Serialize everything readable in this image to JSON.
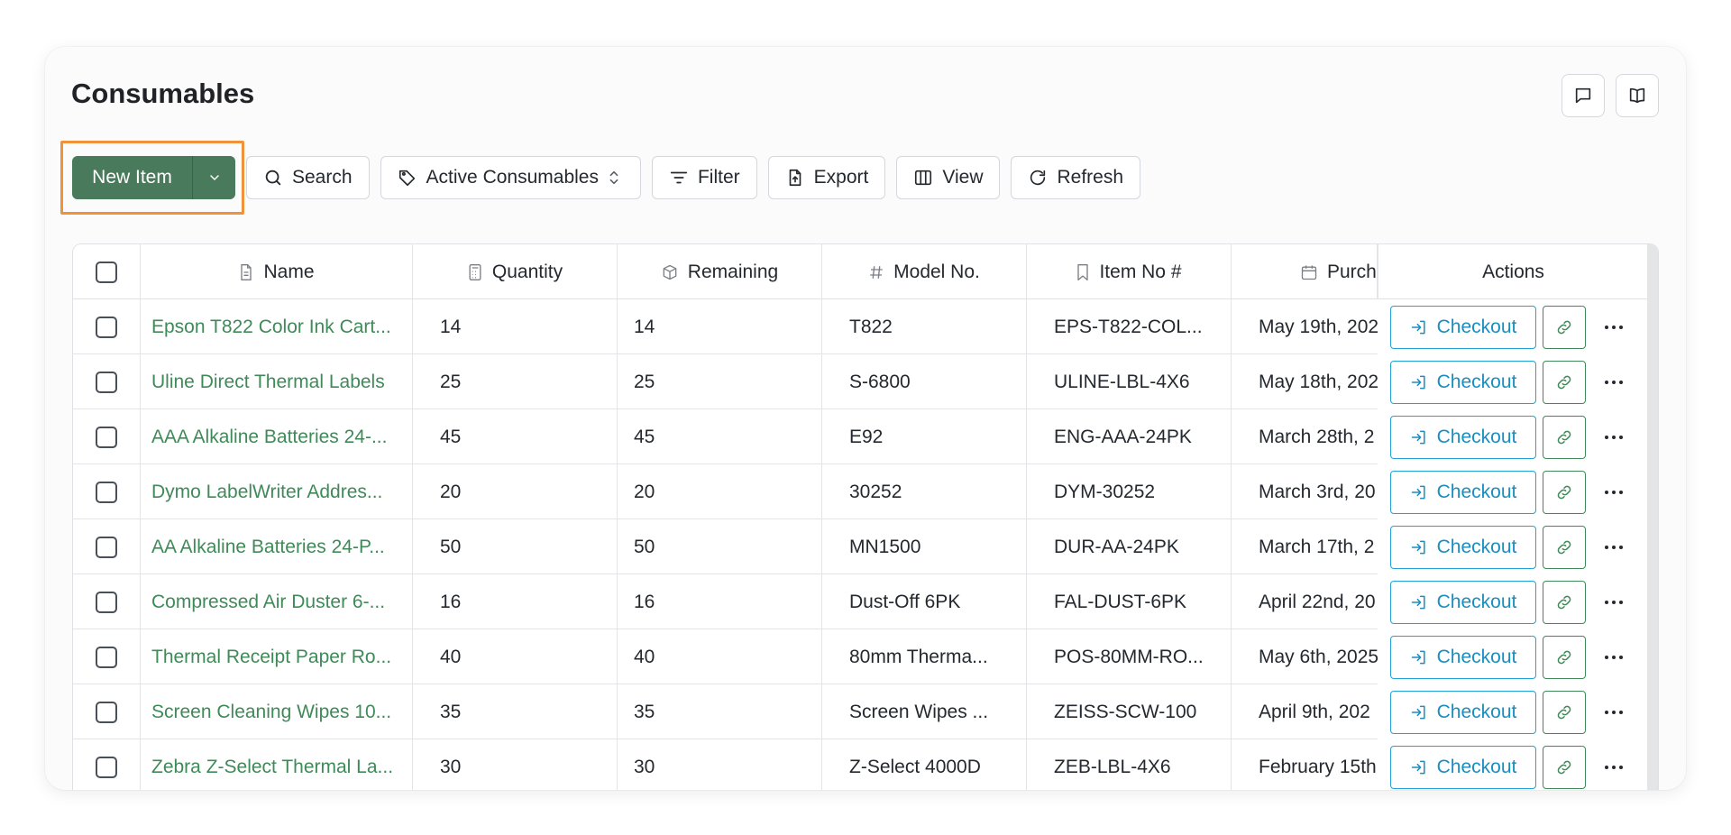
{
  "page": {
    "title": "Consumables"
  },
  "top_icons": [
    {
      "name": "comment-icon"
    },
    {
      "name": "book-icon"
    }
  ],
  "toolbar": {
    "new_item_label": "New Item",
    "search_label": "Search",
    "active_consumables_label": "Active Consumables",
    "filter_label": "Filter",
    "export_label": "Export",
    "view_label": "View",
    "refresh_label": "Refresh"
  },
  "table": {
    "columns": {
      "name": "Name",
      "quantity": "Quantity",
      "remaining": "Remaining",
      "model_no": "Model No.",
      "item_no": "Item No #",
      "purchase": "Purch",
      "actions": "Actions"
    },
    "checkout_label": "Checkout",
    "rows": [
      {
        "name": "Epson T822 Color Ink Cart...",
        "quantity": "14",
        "remaining": "14",
        "model": "T822",
        "item": "EPS-T822-COL...",
        "purchase": "May 19th, 202"
      },
      {
        "name": "Uline Direct Thermal Labels",
        "quantity": "25",
        "remaining": "25",
        "model": "S-6800",
        "item": "ULINE-LBL-4X6",
        "purchase": "May 18th, 202"
      },
      {
        "name": "AAA Alkaline Batteries 24-...",
        "quantity": "45",
        "remaining": "45",
        "model": "E92",
        "item": "ENG-AAA-24PK",
        "purchase": "March 28th, 2"
      },
      {
        "name": "Dymo LabelWriter Addres...",
        "quantity": "20",
        "remaining": "20",
        "model": "30252",
        "item": "DYM-30252",
        "purchase": "March 3rd, 20"
      },
      {
        "name": "AA Alkaline Batteries 24-P...",
        "quantity": "50",
        "remaining": "50",
        "model": "MN1500",
        "item": "DUR-AA-24PK",
        "purchase": "March 17th, 2"
      },
      {
        "name": "Compressed Air Duster 6-...",
        "quantity": "16",
        "remaining": "16",
        "model": "Dust-Off 6PK",
        "item": "FAL-DUST-6PK",
        "purchase": "April 22nd, 20"
      },
      {
        "name": "Thermal Receipt Paper Ro...",
        "quantity": "40",
        "remaining": "40",
        "model": "80mm Therma...",
        "item": "POS-80MM-RO...",
        "purchase": "May 6th, 2025"
      },
      {
        "name": "Screen Cleaning Wipes 10...",
        "quantity": "35",
        "remaining": "35",
        "model": "Screen Wipes ...",
        "item": "ZEISS-SCW-100",
        "purchase": "April 9th, 202"
      },
      {
        "name": "Zebra Z-Select Thermal La...",
        "quantity": "30",
        "remaining": "30",
        "model": "Z-Select 4000D",
        "item": "ZEB-LBL-4X6",
        "purchase": "February 15th"
      }
    ]
  },
  "colors": {
    "primary_green": "#4a7a5c",
    "link_green": "#3f8a58",
    "checkout_blue": "#21a3d6",
    "highlight_orange": "#f0923a"
  }
}
